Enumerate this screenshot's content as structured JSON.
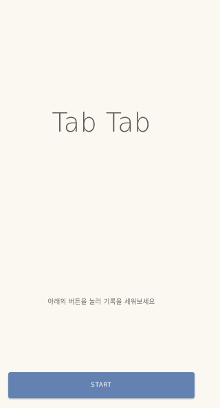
{
  "app": {
    "title": "Tab Tab"
  },
  "main": {
    "instruction": "아래의 버튼을 눌러 기록을 세워보세요"
  },
  "footer": {
    "start_label": "START"
  },
  "colors": {
    "background": "#fbf8f2",
    "title_text": "#5f5a52",
    "button_bg": "#6482b1",
    "button_text": "#ffffff"
  }
}
